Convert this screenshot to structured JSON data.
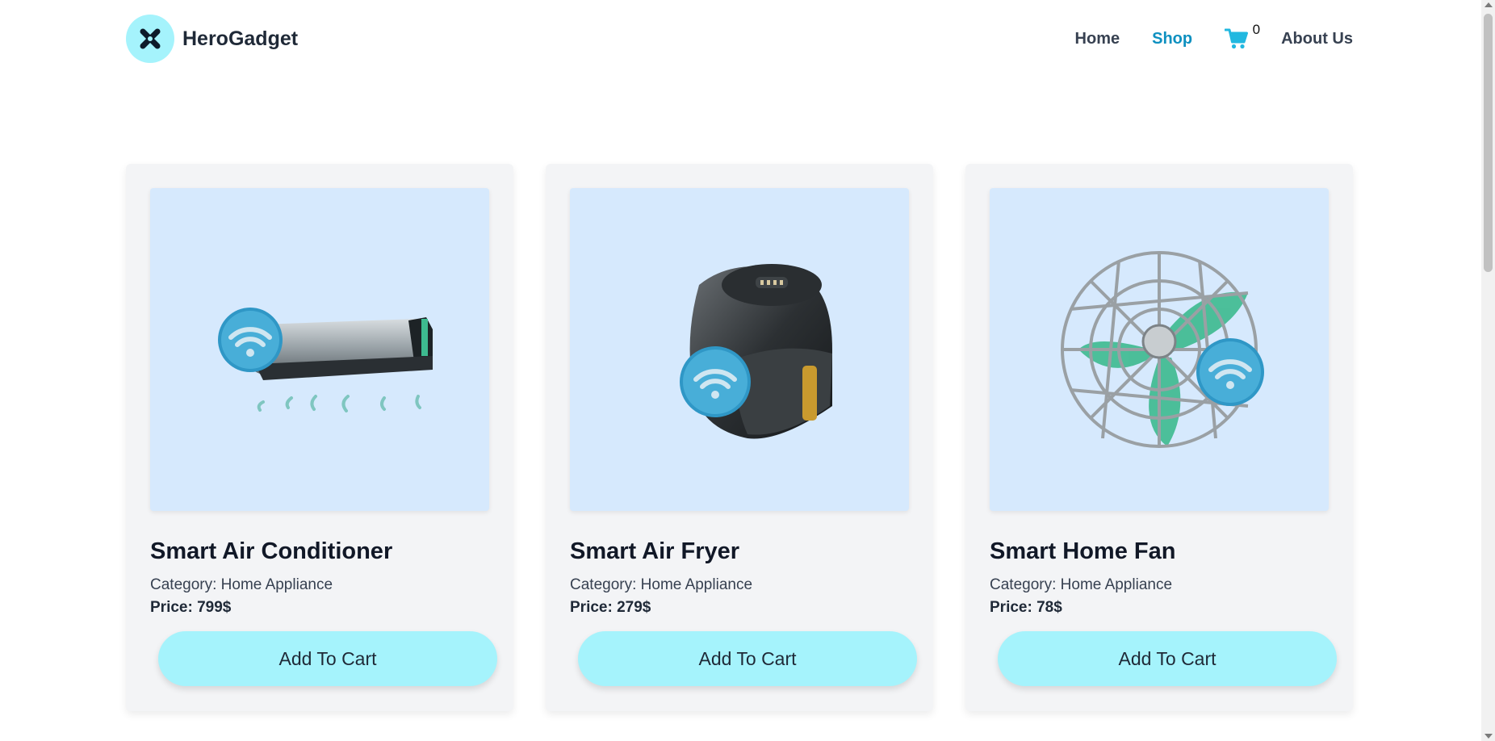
{
  "brand": {
    "name": "HeroGadget",
    "logo_icon": "x-cross-icon",
    "accent": "#a5f3fc"
  },
  "nav": {
    "items": [
      {
        "label": "Home",
        "active": false
      },
      {
        "label": "Shop",
        "active": true
      }
    ],
    "cart": {
      "icon": "cart-icon",
      "count": "0",
      "color": "#22b8e0"
    },
    "about_label": "About Us"
  },
  "products": [
    {
      "title": "Smart Air Conditioner",
      "category": "Category: Home Appliance",
      "price": "Price: 799$",
      "button": "Add To Cart",
      "image_icon": "air-conditioner-icon"
    },
    {
      "title": "Smart Air Fryer",
      "category": "Category: Home Appliance",
      "price": "Price: 279$",
      "button": "Add To Cart",
      "image_icon": "air-fryer-icon"
    },
    {
      "title": "Smart Home Fan",
      "category": "Category: Home Appliance",
      "price": "Price: 78$",
      "button": "Add To Cart",
      "image_icon": "fan-icon"
    }
  ],
  "colors": {
    "card_bg": "#f3f4f6",
    "image_bg": "#d6e9fd",
    "button_bg": "#a5f3fc",
    "active_link": "#0e90c0"
  }
}
